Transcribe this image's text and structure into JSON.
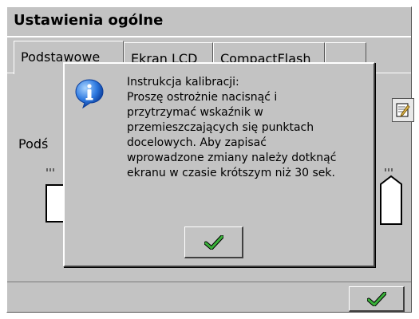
{
  "window": {
    "title": "Ustawienia ogólne"
  },
  "tabs": [
    {
      "label": "Podstawowe"
    },
    {
      "label": "Ekran LCD"
    },
    {
      "label": "CompactFlash"
    },
    {
      "label": ""
    }
  ],
  "background": {
    "label": "Podś"
  },
  "dialog": {
    "icon": "info-icon",
    "lines": [
      "Instrukcja kalibracji:",
      "Proszę ostrożnie nacisnąć i",
      "przytrzymać wskaźnik w",
      "przemieszczających się punktach",
      "docelowych. Aby zapisać",
      "wprowadzone zmiany należy dotknąć",
      "ekranu w czasie krótszym niż 30 sek."
    ],
    "ok_icon": "checkmark-icon"
  },
  "footer": {
    "ok_icon": "checkmark-icon"
  },
  "colors": {
    "window_bg": "#c3c3c3",
    "checkmark": "#2e9b2e",
    "info_blue": "#1e5fc8"
  }
}
